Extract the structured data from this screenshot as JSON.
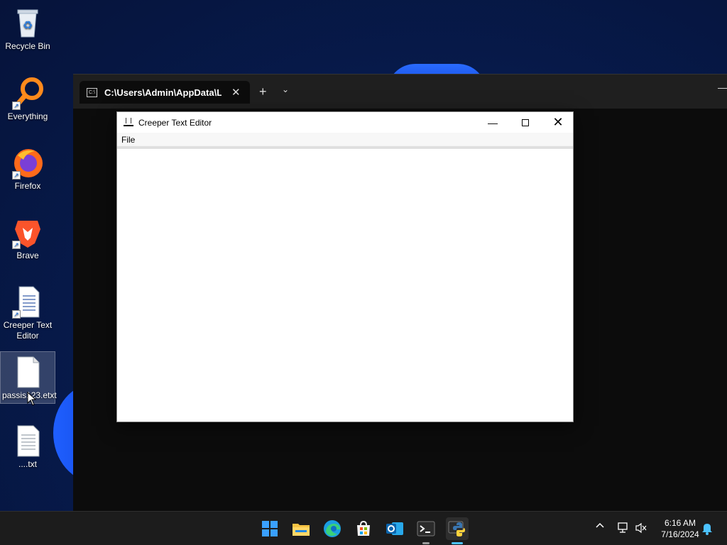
{
  "desktop": {
    "icons": [
      {
        "label": "Recycle Bin"
      },
      {
        "label": "Everything"
      },
      {
        "label": "Firefox"
      },
      {
        "label": "Brave"
      },
      {
        "label": "Creeper Text Editor"
      },
      {
        "label": "passis123.etxt"
      },
      {
        "label": "....txt"
      }
    ]
  },
  "terminal": {
    "tab_title": "C:\\Users\\Admin\\AppData\\Loc",
    "tab_close": "✕",
    "new_tab": "+",
    "dropdown": "⌄",
    "minimize": "—"
  },
  "editor": {
    "title": "Creeper Text Editor",
    "menu": [
      "File"
    ],
    "minimize": "—",
    "close": "✕"
  },
  "taskbar": {
    "time": "6:16 AM",
    "date": "7/16/2024",
    "tray_chevron": "^"
  }
}
